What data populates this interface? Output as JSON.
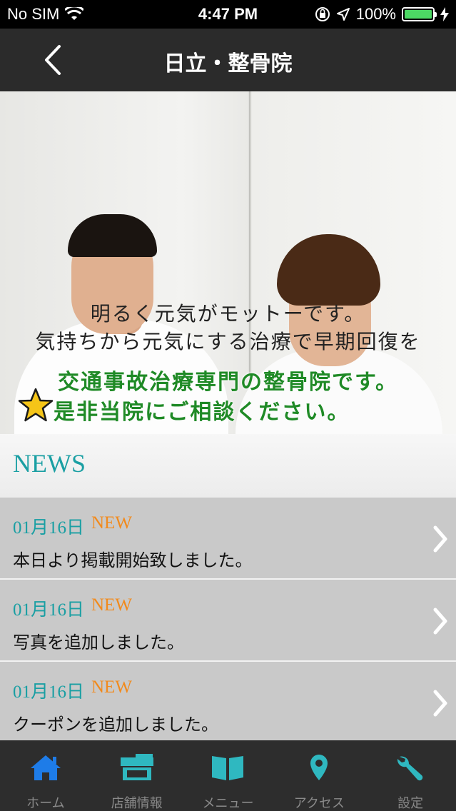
{
  "status_bar": {
    "carrier": "No SIM",
    "time": "4:47 PM",
    "battery": "100%"
  },
  "nav": {
    "title": "日立・整骨院"
  },
  "hero": {
    "line1": "明るく元気がモットーです。",
    "line2": "気持ちから元気にする治療で早期回復を",
    "line3": "交通事故治療専門の整骨院です。",
    "line4": "是非当院にご相談ください。"
  },
  "news": {
    "title": "NEWS",
    "items": [
      {
        "date": "01月16日",
        "badge": "NEW",
        "text": "本日より掲載開始致しました。"
      },
      {
        "date": "01月16日",
        "badge": "NEW",
        "text": "写真を追加しました。"
      },
      {
        "date": "01月16日",
        "badge": "NEW",
        "text": "クーポンを追加しました。"
      }
    ]
  },
  "tabs": [
    {
      "label": "ホーム",
      "icon": "home-icon",
      "active": true
    },
    {
      "label": "店舗情報",
      "icon": "store-icon",
      "active": false
    },
    {
      "label": "メニュー",
      "icon": "book-icon",
      "active": false
    },
    {
      "label": "アクセス",
      "icon": "map-pin-icon",
      "active": false
    },
    {
      "label": "設定",
      "icon": "wrench-icon",
      "active": false
    }
  ],
  "colors": {
    "accent_teal": "#1a9fa3",
    "badge_orange": "#f28a1c",
    "active_tab_blue": "#1e7ce8",
    "inactive_tab_icon": "#2fb8c0",
    "hero_green": "#1f8a26"
  }
}
